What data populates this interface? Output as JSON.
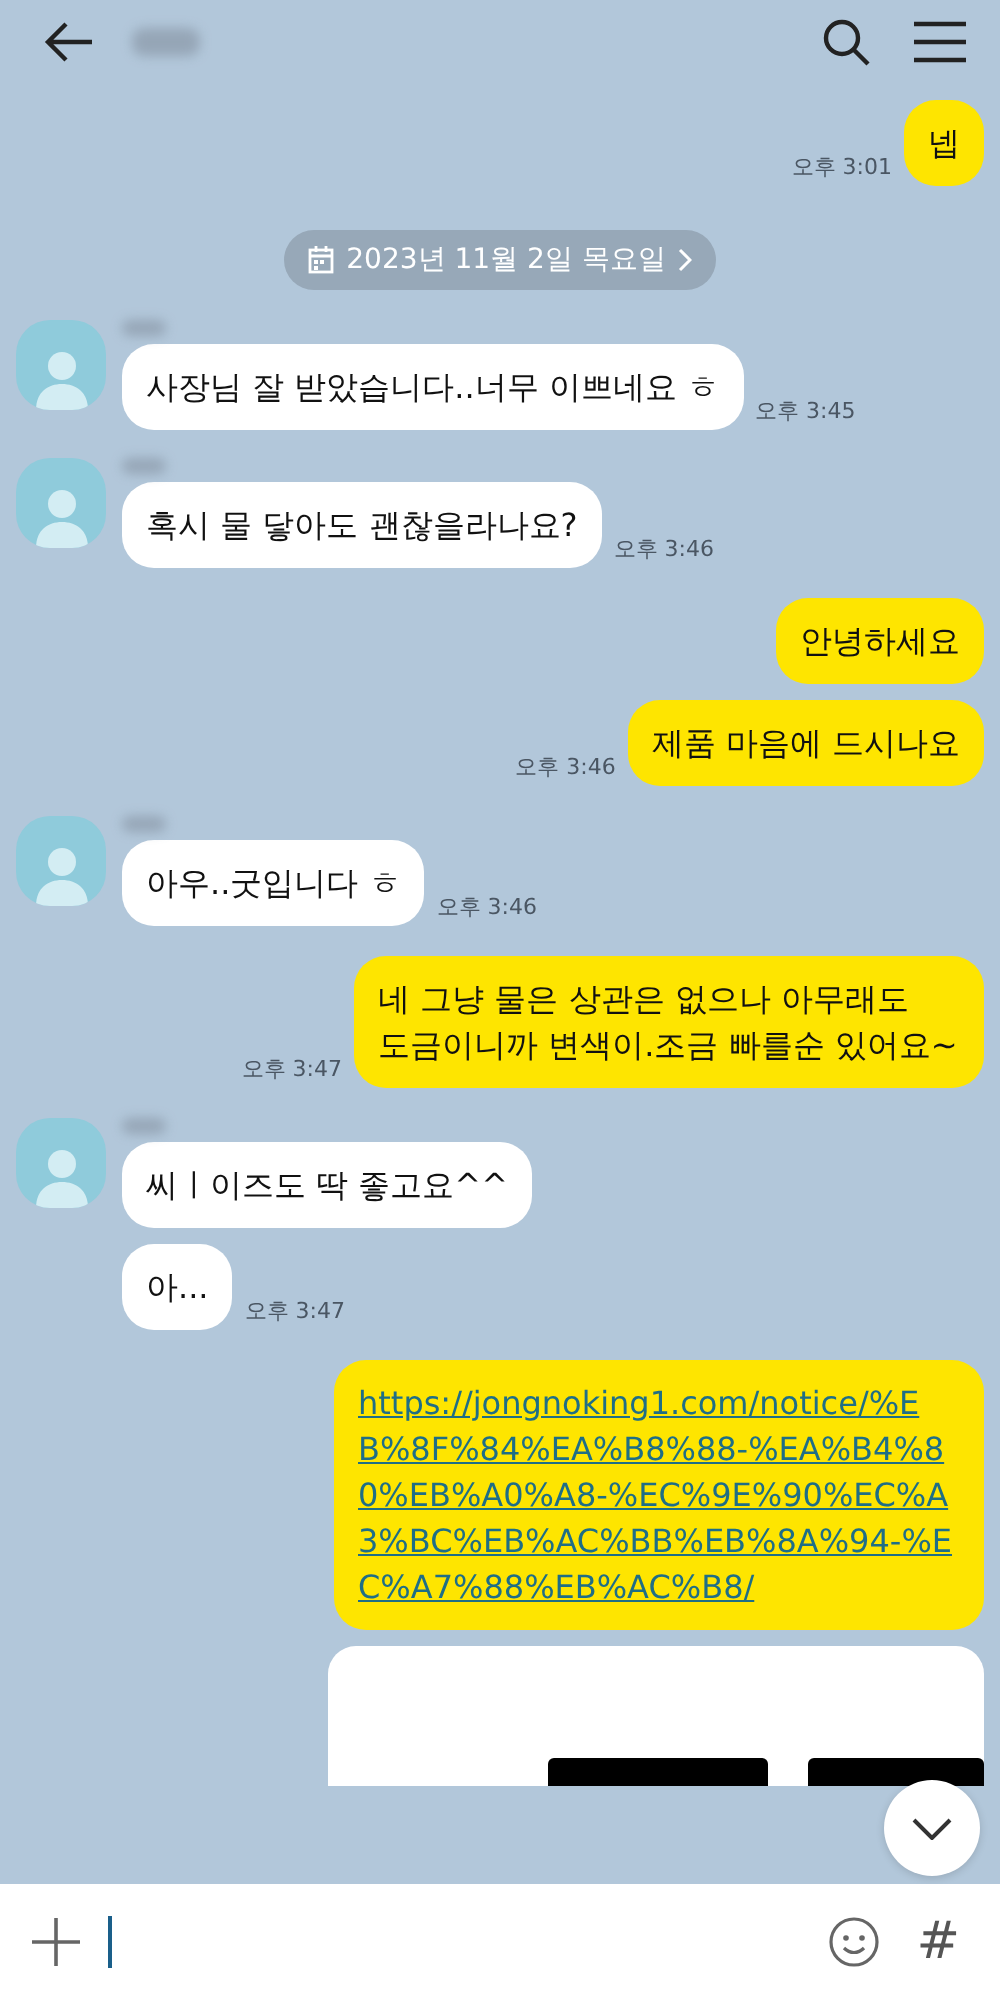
{
  "messages": [
    {
      "kind": "text",
      "outgoing": true,
      "text": "넵",
      "time": "오후 3:01"
    },
    {
      "kind": "date",
      "text": "2023년 11월 2일 목요일"
    },
    {
      "kind": "text",
      "outgoing": false,
      "avatar": true,
      "text": "사장님 잘 받았습니다..너무 이쁘네요 ㅎ",
      "time": "오후 3:45"
    },
    {
      "kind": "text",
      "outgoing": false,
      "avatar": true,
      "text": "혹시 물 닿아도 괜찮을라나요?",
      "time": "오후 3:46"
    },
    {
      "kind": "text",
      "outgoing": true,
      "text": "안녕하세요"
    },
    {
      "kind": "text",
      "outgoing": true,
      "text": "제품 마음에 드시나요",
      "time": "오후 3:46"
    },
    {
      "kind": "text",
      "outgoing": false,
      "avatar": true,
      "text": "아우..굿입니다 ㅎ",
      "time": "오후 3:46"
    },
    {
      "kind": "text",
      "outgoing": true,
      "text": "네 그냥 물은 상관은 없으나 아무래도 도금이니까 변색이.조금 빠를순 있어요~",
      "time": "오후 3:47"
    },
    {
      "kind": "text",
      "outgoing": false,
      "avatar": true,
      "text": "씨ㅣ이즈도 딱 좋고요^^"
    },
    {
      "kind": "text",
      "outgoing": false,
      "avatar": false,
      "text": "아...",
      "time": "오후 3:47"
    },
    {
      "kind": "link",
      "outgoing": true,
      "text": "https://jongnoking1.com/notice/%EB%8F%84%EA%B8%88-%EA%B4%80%EB%A0%A8-%EC%9E%90%EC%A3%BC%EB%AC%BB%EB%8A%94-%EC%A7%88%EB%AC%B8/"
    },
    {
      "kind": "card",
      "outgoing": true
    }
  ],
  "composer": {
    "hashtag": "#"
  }
}
